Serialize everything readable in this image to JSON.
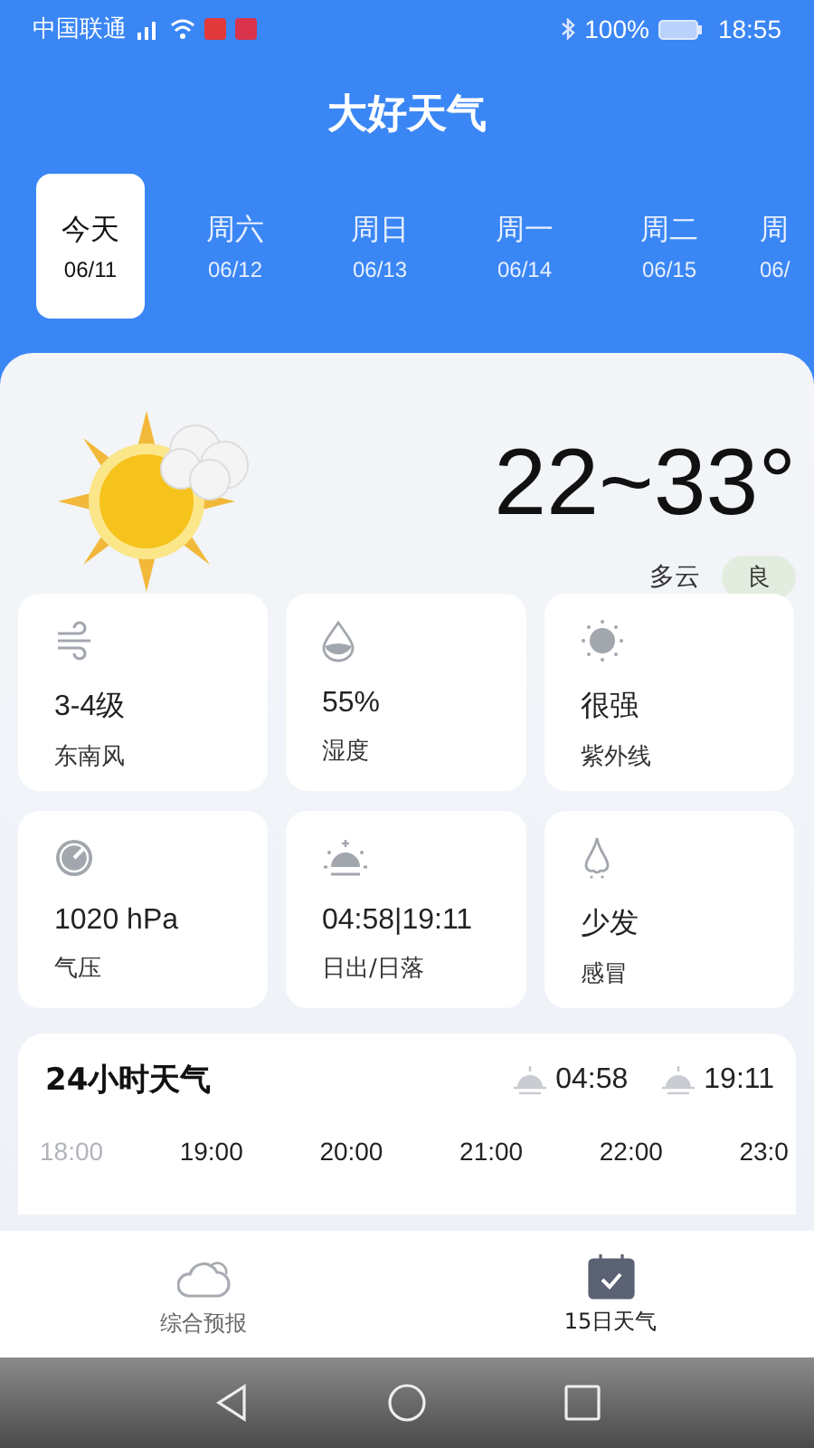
{
  "status_bar": {
    "carrier": "中国联通",
    "battery": "100%",
    "time": "18:55"
  },
  "app_title": "大好天气",
  "days": [
    {
      "label": "今天",
      "date": "06/11",
      "selected": true
    },
    {
      "label": "周六",
      "date": "06/12",
      "selected": false
    },
    {
      "label": "周日",
      "date": "06/13",
      "selected": false
    },
    {
      "label": "周一",
      "date": "06/14",
      "selected": false
    },
    {
      "label": "周二",
      "date": "06/15",
      "selected": false
    },
    {
      "label": "周",
      "date": "06/",
      "selected": false
    }
  ],
  "today": {
    "temperature": "22~33°",
    "condition": "多云",
    "air_quality": "良"
  },
  "details": [
    {
      "kind": "wind",
      "value": "3-4级",
      "label": "东南风"
    },
    {
      "kind": "humidity",
      "value": "55%",
      "label": "湿度"
    },
    {
      "kind": "uv",
      "value": "很强",
      "label": "紫外线"
    },
    {
      "kind": "pressure",
      "value": "1020 hPa",
      "label": "气压"
    },
    {
      "kind": "sun",
      "value": "04:58|19:11",
      "label": "日出/日落"
    },
    {
      "kind": "cold",
      "value": "少发",
      "label": "感冒"
    }
  ],
  "hourly": {
    "title": "24小时天气",
    "sunrise": "04:58",
    "sunset": "19:11",
    "hours": [
      {
        "time": "18:00",
        "past": true
      },
      {
        "time": "19:00",
        "past": false
      },
      {
        "time": "20:00",
        "past": false
      },
      {
        "time": "21:00",
        "past": false
      },
      {
        "time": "22:00",
        "past": false
      },
      {
        "time": "23:0",
        "past": false
      }
    ]
  },
  "bottom_tabs": [
    {
      "kind": "forecast",
      "label": "综合预报",
      "selected": false
    },
    {
      "kind": "calendar",
      "label": "15日天气",
      "selected": true
    }
  ]
}
